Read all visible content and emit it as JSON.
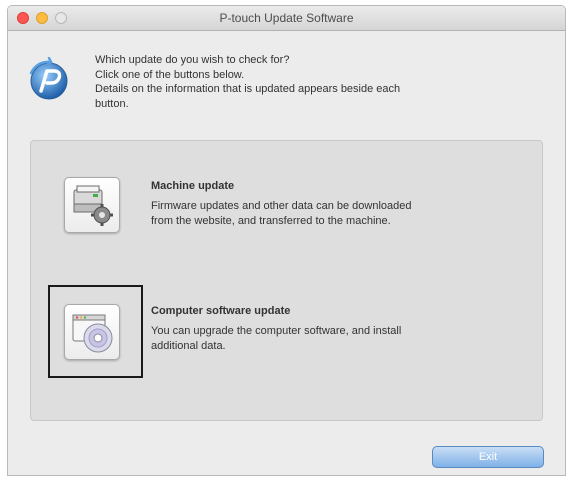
{
  "window": {
    "title": "P-touch Update Software"
  },
  "intro": {
    "line1": "Which update do you wish to check for?",
    "line2": "Click one of the buttons below.",
    "line3": "Details on the information that is updated appears beside each",
    "line4": "button."
  },
  "options": {
    "machine": {
      "title": "Machine update",
      "desc_line1": "Firmware updates and other data can be downloaded",
      "desc_line2": "from the website, and transferred to the machine."
    },
    "computer": {
      "title": "Computer software update",
      "desc_line1": "You can upgrade the computer software, and install",
      "desc_line2": "additional data."
    }
  },
  "footer": {
    "exit_label": "Exit"
  },
  "colors": {
    "accent": "#7fb1e8",
    "close": "#fc5753",
    "minimize": "#fdbc40"
  }
}
